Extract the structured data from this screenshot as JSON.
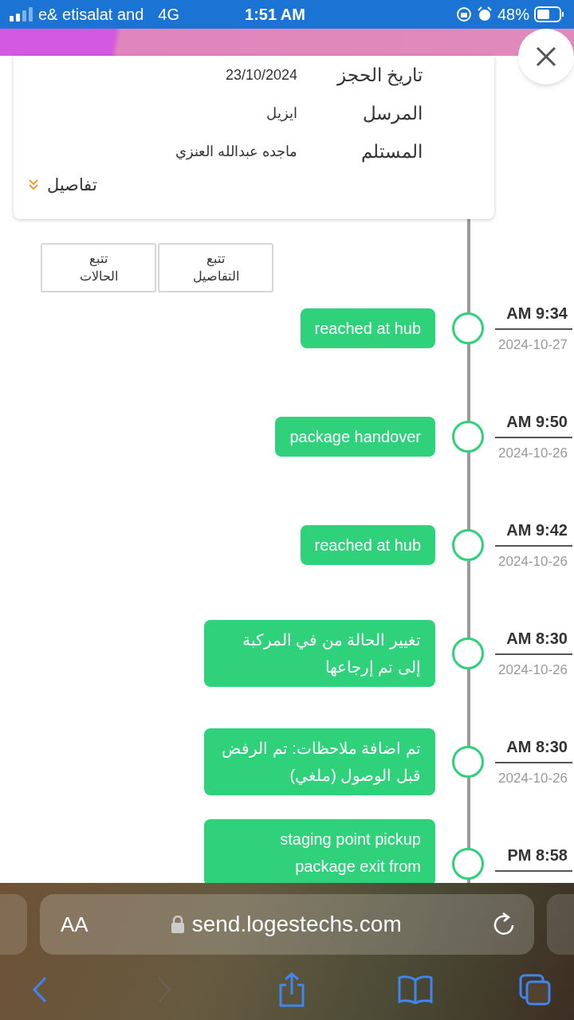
{
  "status_bar": {
    "carrier": "e& etisalat and",
    "network": "4G",
    "time": "1:51 AM",
    "battery": "48%"
  },
  "details_card": {
    "rows": [
      {
        "label": "تاريخ الحجز",
        "value": "23/10/2024"
      },
      {
        "label": "المرسل",
        "value": "ايزيل"
      },
      {
        "label": "المستلم",
        "value": "ماجده عبدالله العنزي"
      }
    ],
    "more_link": "تفاصيل"
  },
  "tabs": [
    {
      "label": "تتبع التفاصيل"
    },
    {
      "label": "تتبع الحالات"
    }
  ],
  "events": [
    {
      "text": "reached at hub",
      "time": "AM 9:34",
      "date": "2024-10-27"
    },
    {
      "text": "package handover",
      "time": "AM 9:50",
      "date": "2024-10-26"
    },
    {
      "text": "reached at hub",
      "time": "AM 9:42",
      "date": "2024-10-26"
    },
    {
      "text": "تغيير الحالة من في المركبة إلى تم إرجاعها",
      "time": "AM 8:30",
      "date": "2024-10-26"
    },
    {
      "text": "تم اضافة ملاحظات: تم الرفض قبل الوصول (ملغي)",
      "time": "AM 8:30",
      "date": "2024-10-26"
    },
    {
      "text": "staging point pickup package exit from",
      "time": "PM 8:58"
    }
  ],
  "browser": {
    "text_size": "AA",
    "url": "send.logestechs.com"
  }
}
